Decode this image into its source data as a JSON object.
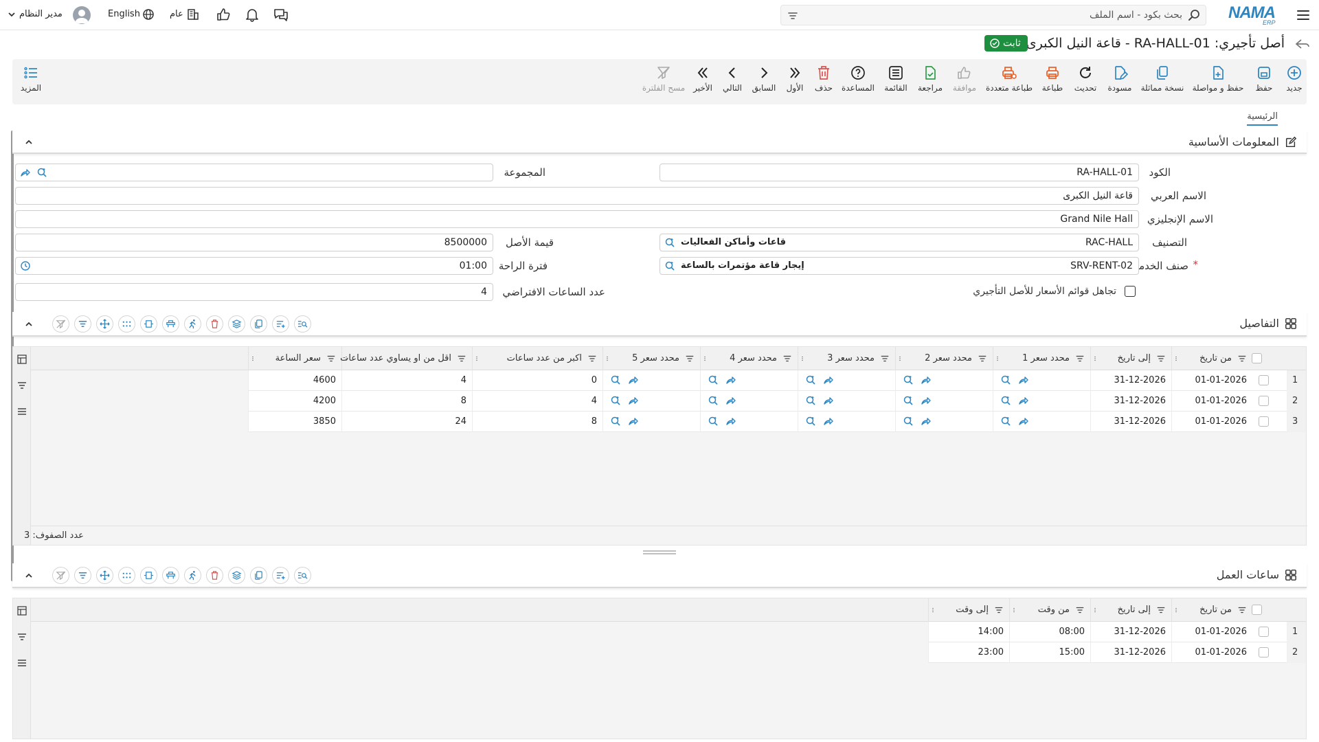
{
  "topbar": {
    "search_placeholder": "بحث بكود - اسم الملف",
    "user_name": "مدير النظام",
    "language": "English",
    "branch": "عام",
    "logo_text": "NAMA",
    "logo_sub": "ERP"
  },
  "page": {
    "title": "أصل تأجيري: RA-HALL-01 - قاعة النيل الكبرى",
    "status": "ثابت"
  },
  "toolbar": {
    "new": "جديد",
    "save": "حفظ",
    "save_continue": "حفظ و مواصلة",
    "duplicate": "نسخة مماثلة",
    "draft": "مسودة",
    "refresh": "تحديث",
    "print": "طباعة",
    "multi_print": "طباعة متعددة",
    "approve": "موافقة",
    "review": "مراجعة",
    "list": "القائمة",
    "help": "المساعدة",
    "delete": "حذف",
    "first": "الأول",
    "previous": "السابق",
    "next": "التالي",
    "last": "الأخير",
    "clear_filter": "مسح الفلترة",
    "more": "المزيد"
  },
  "tabs": {
    "main": "الرئيسية"
  },
  "basic": {
    "section_title": "المعلومات الأساسية",
    "code_label": "الكود",
    "code_value": "RA-HALL-01",
    "group_label": "المجموعة",
    "group_value": "",
    "arabic_name_label": "الاسم العربي",
    "arabic_name_value": "قاعة النيل الكبرى",
    "english_name_label": "الاسم الإنجليزي",
    "english_name_value": "Grand Nile Hall",
    "category_label": "التصنيف",
    "category_code": "RAC-HALL",
    "category_name": "قاعات وأماكن الفعاليات",
    "asset_value_label": "قيمة الأصل",
    "asset_value": "8500000",
    "service_label": "صنف الخدمة",
    "service_code": "SRV-RENT-02",
    "service_name": "إيجار قاعة مؤتمرات بالساعة",
    "rest_label": "فترة الراحة",
    "rest_value": "01:00",
    "default_hours_label": "عدد الساعات الافتراضي",
    "default_hours_value": "4",
    "ignore_price_label": "تجاهل قوائم الأسعار للأصل التأجيري",
    "ignore_price_checked": false
  },
  "details": {
    "section_title": "التفاصيل",
    "columns": [
      "من تاريخ",
      "إلى تاريخ",
      "محدد سعر 1",
      "محدد سعر 2",
      "محدد سعر 3",
      "محدد سعر 4",
      "محدد سعر 5",
      "اكبر من عدد ساعات",
      "اقل من او يساوي عدد ساعات",
      "سعر الساعة"
    ],
    "rows": [
      {
        "n": "1",
        "from": "01-01-2026",
        "to": "31-12-2026",
        "gt": "0",
        "lte": "4",
        "price": "4600"
      },
      {
        "n": "2",
        "from": "01-01-2026",
        "to": "31-12-2026",
        "gt": "4",
        "lte": "8",
        "price": "4200"
      },
      {
        "n": "3",
        "from": "01-01-2026",
        "to": "31-12-2026",
        "gt": "8",
        "lte": "24",
        "price": "3850"
      }
    ],
    "row_count": "عدد الصفوف: 3"
  },
  "hours": {
    "section_title": "ساعات العمل",
    "columns": [
      "من تاريخ",
      "إلى تاريخ",
      "من وقت",
      "إلى وقت"
    ],
    "rows": [
      {
        "n": "1",
        "from": "01-01-2026",
        "to": "31-12-2026",
        "tfrom": "08:00",
        "tto": "14:00"
      },
      {
        "n": "2",
        "from": "01-01-2026",
        "to": "31-12-2026",
        "tfrom": "15:00",
        "tto": "23:00"
      }
    ]
  },
  "colors": {
    "accent": "#2e86c1",
    "status_green": "#1e8f3e",
    "delete_red": "#d9534f",
    "print_orange": "#e8632b"
  }
}
